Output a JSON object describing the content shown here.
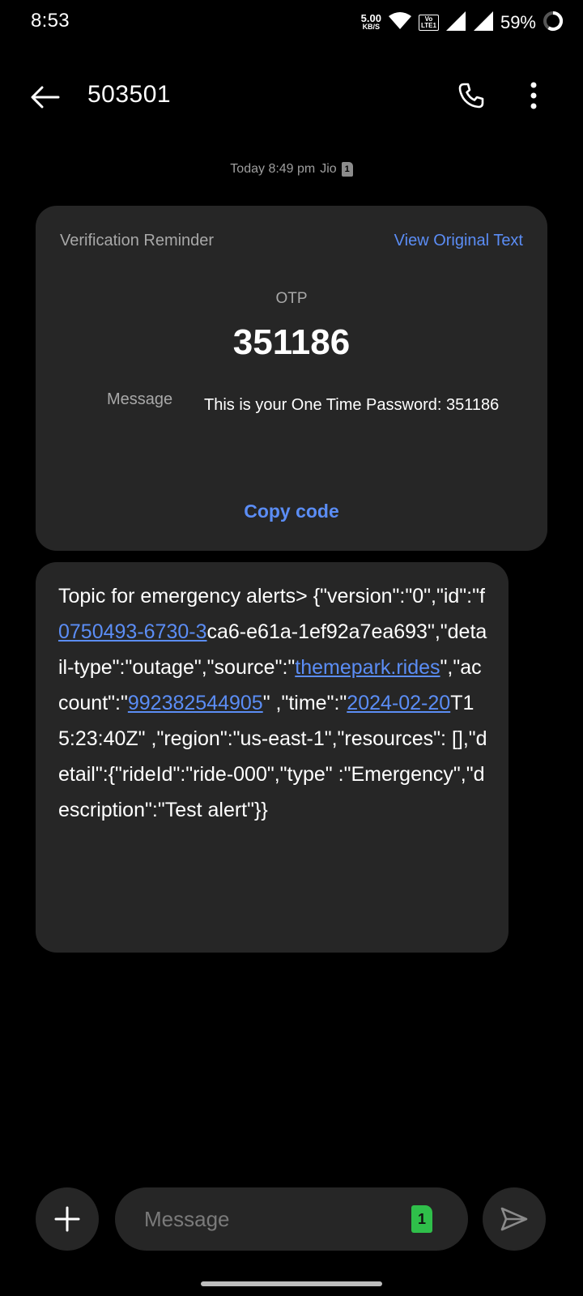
{
  "status_bar": {
    "time": "8:53",
    "net_speed_value": "5.00",
    "net_speed_unit": "KB/S",
    "volte_top": "Vo",
    "volte_bottom": "LTE",
    "volte_sim": "1",
    "battery_percent": "59%",
    "icons": [
      "wifi-icon",
      "volte-icon",
      "signal-icon",
      "signal-icon",
      "battery-ring-icon"
    ]
  },
  "header": {
    "title": "503501",
    "icons": [
      "back-arrow-icon",
      "phone-icon",
      "more-vertical-icon"
    ]
  },
  "timestamp": {
    "text": "Today 8:49 pm",
    "carrier": "Jio",
    "sim": "1"
  },
  "otp_card": {
    "title": "Verification Reminder",
    "view_original": "View Original Text",
    "otp_label": "OTP",
    "otp_code": "351186",
    "message_label": "Message",
    "message_text": "This is your One Time Password: 351186",
    "copy_code": "Copy code"
  },
  "message": {
    "parts": [
      {
        "text": "Topic for emergency alerts> {\"version\":\"0\",\"id\":\"f"
      },
      {
        "link": "0750493-6730-3"
      },
      {
        "text": "ca6-e61a-1ef92a7ea693\",\"detail-type\":\"outage\",\"source\":\""
      },
      {
        "link": "themepark.rides"
      },
      {
        "text": "\",\"account\":\""
      },
      {
        "link": "992382544905"
      },
      {
        "text": "\" ,\"time\":\""
      },
      {
        "link": "2024-02-20"
      },
      {
        "text": "T15:23:40Z\" ,\"region\":\"us-east-1\",\"resources\": [],\"detail\":{\"rideId\":\"ride-000\",\"type\" :\"Emergency\",\"description\":\"Test alert\"}}"
      }
    ]
  },
  "composer": {
    "placeholder": "Message",
    "sim": "1",
    "icons": [
      "plus-icon",
      "send-icon"
    ]
  },
  "colors": {
    "background": "#000000",
    "bubble": "#262626",
    "accent_link": "#5b8df5",
    "sim_green": "#2fbf4a"
  }
}
